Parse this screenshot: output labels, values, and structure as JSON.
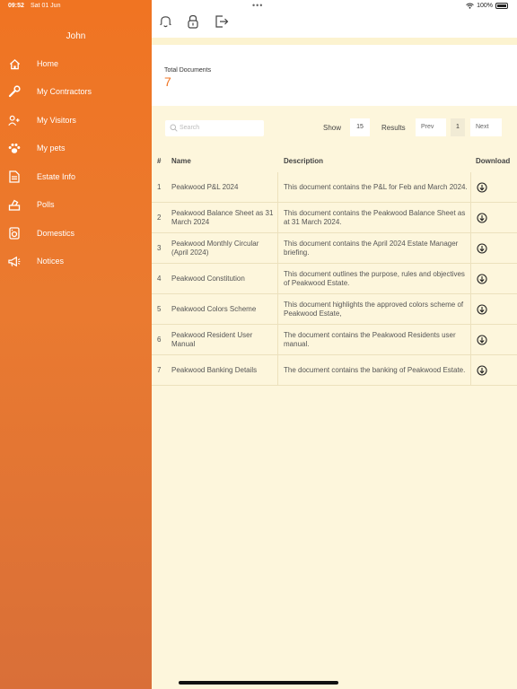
{
  "status": {
    "time": "09:52",
    "date": "Sat 01 Jun",
    "battery": "100%"
  },
  "user": {
    "name": "John"
  },
  "nav": [
    {
      "label": "Home",
      "icon": "home-icon"
    },
    {
      "label": "My Contractors",
      "icon": "wrench-icon"
    },
    {
      "label": "My Visitors",
      "icon": "add-person-icon"
    },
    {
      "label": "My pets",
      "icon": "paw-icon"
    },
    {
      "label": "Estate Info",
      "icon": "document-icon"
    },
    {
      "label": "Polls",
      "icon": "ballot-box-icon"
    },
    {
      "label": "Domestics",
      "icon": "domestics-icon"
    },
    {
      "label": "Notices",
      "icon": "megaphone-icon"
    }
  ],
  "summary": {
    "title": "Total Documents",
    "value": "7"
  },
  "controls": {
    "search_placeholder": "Search",
    "show_label": "Show",
    "show_value": "15",
    "results_label": "Results",
    "prev": "Prev",
    "page": "1",
    "next": "Next"
  },
  "table": {
    "headers": {
      "num": "#",
      "name": "Name",
      "description": "Description",
      "download": "Download"
    },
    "rows": [
      {
        "num": "1",
        "name": "Peakwood P&L 2024",
        "description": "This document contains the P&L for Feb and March 2024."
      },
      {
        "num": "2",
        "name": "Peakwood Balance Sheet as 31 March 2024",
        "description": "This document contains the Peakwood Balance Sheet as at 31 March 2024."
      },
      {
        "num": "3",
        "name": "Peakwood Monthly Circular (April 2024)",
        "description": "This document contains the April 2024 Estate Manager briefing."
      },
      {
        "num": "4",
        "name": "Peakwood Constitution",
        "description": "This document outlines the purpose, rules and objectives of Peakwood Estate."
      },
      {
        "num": "5",
        "name": "Peakwood Colors Scheme",
        "description": "This document highlights the approved colors scheme of Peakwood Estate,"
      },
      {
        "num": "6",
        "name": "Peakwood Resident User Manual",
        "description": "The document contains the Peakwood Residents user manual."
      },
      {
        "num": "7",
        "name": "Peakwood Banking Details",
        "description": "The document contains the banking of Peakwood Estate."
      }
    ]
  },
  "colors": {
    "accent": "#f07422",
    "background": "#fdf6dc"
  }
}
